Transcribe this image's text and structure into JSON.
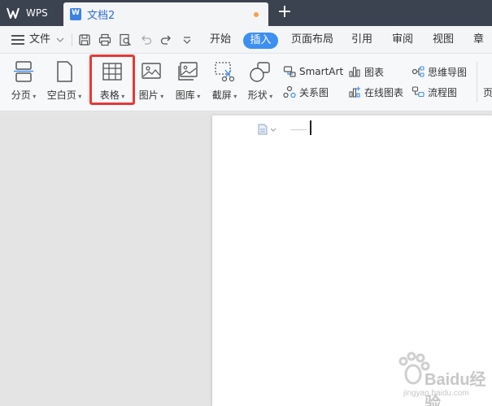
{
  "app": {
    "name": "WPS",
    "document_tab": "文档2",
    "new_tab_symbol": "+",
    "unsaved_dot_color": "#f5a04a"
  },
  "menubar": {
    "file_label": "文件",
    "tabs": [
      "开始",
      "插入",
      "页面布局",
      "引用",
      "审阅",
      "视图",
      "章节"
    ],
    "active_tab": "插入",
    "accent_color": "#3d8ff1",
    "quick_icons": [
      "save-icon",
      "print-icon",
      "print-preview-icon",
      "undo-icon",
      "redo-icon",
      "more-dropdown-icon"
    ]
  },
  "ribbon": {
    "page_break": "分页",
    "blank_page": "空白页",
    "table": "表格",
    "picture": "图片",
    "gallery": "图库",
    "screenshot": "截屏",
    "shape": "形状",
    "smartart": "SmartArt",
    "relation_chart": "关系图",
    "chart": "图表",
    "online_chart": "在线图表",
    "mind_map": "思维导图",
    "flowchart": "流程图",
    "cut_off_label": "页"
  },
  "highlight": {
    "color": "#e53935",
    "target": "表格"
  },
  "watermark": {
    "brand_text": "Baidu经验",
    "url": "jingyan.baidu.com"
  }
}
